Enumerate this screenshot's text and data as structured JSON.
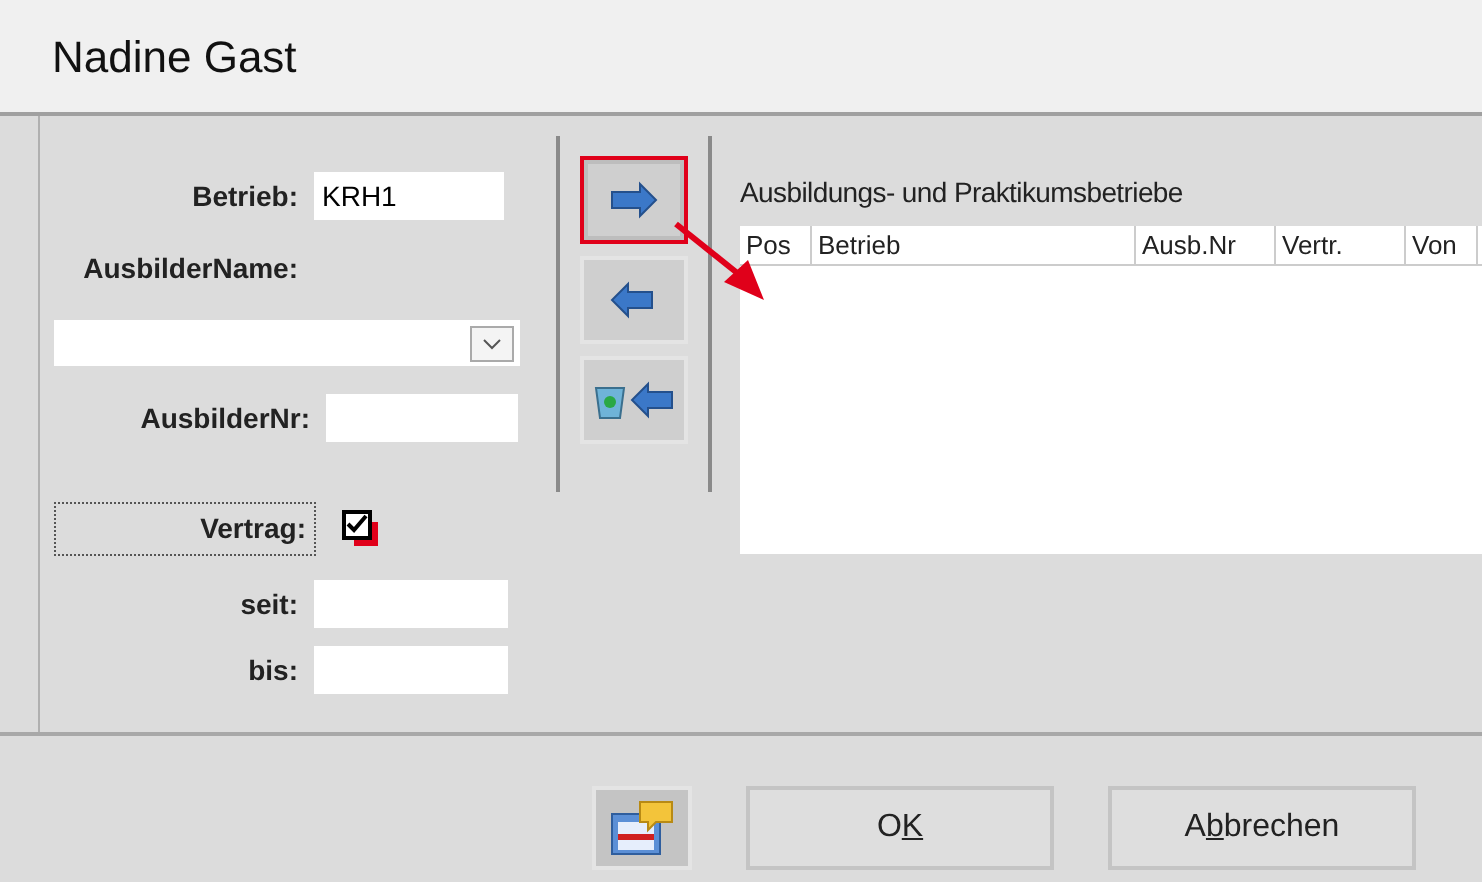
{
  "window": {
    "title": "Nadine Gast"
  },
  "form": {
    "betrieb": {
      "label": "Betrieb:",
      "value": "KRH1"
    },
    "ausbilder_name": {
      "label": "AusbilderName:"
    },
    "ausbilder_nr": {
      "label": "AusbilderNr:"
    },
    "vertrag": {
      "label": "Vertrag:",
      "checked": true,
      "focused": true
    },
    "seit": {
      "label": "seit:"
    },
    "bis": {
      "label": "bis:"
    }
  },
  "transfer_buttons": [
    {
      "kind": "add",
      "highlighted": true
    },
    {
      "kind": "remove",
      "highlighted": false
    },
    {
      "kind": "remove-all",
      "highlighted": false
    }
  ],
  "table": {
    "title": "Ausbildungs- und Praktikumsbetriebe",
    "columns": [
      "Pos",
      "Betrieb",
      "Ausb.Nr",
      "Vertr.",
      "Von"
    ]
  },
  "buttons": [
    {
      "before": "O",
      "access_key": "K"
    },
    {
      "before": "A",
      "access_key": "b",
      "after": "brechen"
    }
  ]
}
